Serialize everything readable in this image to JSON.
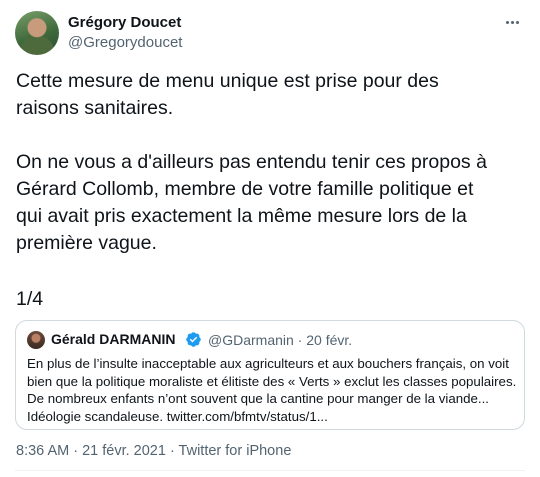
{
  "author": {
    "name": "Grégory Doucet",
    "handle": "@Gregorydoucet"
  },
  "tweet": {
    "paragraph_1": "Cette mesure de menu unique est prise pour des\nraisons sanitaires.",
    "paragraph_2": "On ne vous a d'ailleurs pas entendu tenir ces propos à\nGérard Collomb, membre de votre famille politique et\nqui avait pris exactement la même mesure lors de la\npremière vague.",
    "counter": "1/4"
  },
  "quoted_tweet": {
    "name": "Gérald DARMANIN",
    "meta": "@GDarmanin · 20 févr.",
    "text": "En plus de l’insulte inacceptable aux agriculteurs et aux bouchers français, on voit\nbien que la politique moraliste et élitiste des « Verts » exclut les classes populaires.\nDe nombreux enfants n’ont souvent que la cantine pour manger de la viande...\nIdéologie scandaleuse. twitter.com/bfmtv/status/1..."
  },
  "footer": {
    "meta": "8:36 AM · 21 févr. 2021 · Twitter for iPhone"
  },
  "icons": {
    "more": "more-horizontal-icon",
    "verified": "verified-badge-icon"
  },
  "colors": {
    "text_primary": "#0f1419",
    "text_secondary": "#536471",
    "verified": "#1d9bf0",
    "border": "#cfd9de"
  }
}
